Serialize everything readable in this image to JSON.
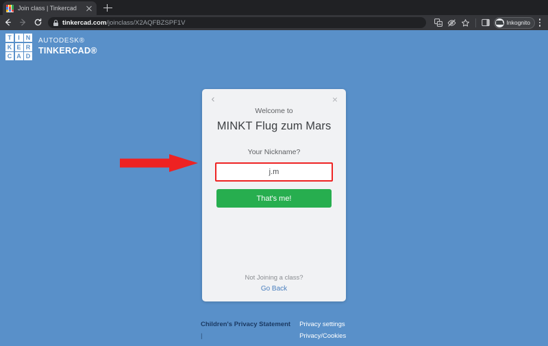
{
  "browser": {
    "tab": {
      "title": "Join class | Tinkercad",
      "favicon": "tinkercad-favicon",
      "close_label": "×",
      "favicon_colors": [
        "#e8453c",
        "#f7b500",
        "#34a853",
        "#4285f4",
        "#e8453c",
        "#34a853",
        "#f7b500",
        "#4285f4",
        "#e8453c"
      ]
    },
    "new_tab_label": "+",
    "nav": {
      "back": "←",
      "forward": "→",
      "reload": "↻"
    },
    "omnibox": {
      "lock_icon": "lock-icon",
      "host": "tinkercad.com",
      "path": "/joinclass/X2AQFBZSPF1V"
    },
    "toolbar_icons": [
      {
        "name": "translate-icon",
        "glyph": "語"
      },
      {
        "name": "eye-slash-icon",
        "glyph": "◎"
      },
      {
        "name": "bookmark-star-icon",
        "glyph": "☆"
      },
      {
        "name": "side-panel-icon",
        "glyph": "▣"
      }
    ],
    "profile": {
      "name": "Inkognito",
      "avatar": "incognito-avatar"
    },
    "menu_label": "⋮"
  },
  "brand": {
    "grid_letters": [
      "T",
      "I",
      "N",
      "K",
      "E",
      "R",
      "C",
      "A",
      "D"
    ],
    "line1": "AUTODESK®",
    "line2": "TINKERCAD®"
  },
  "modal": {
    "back_label": "‹",
    "close_label": "×",
    "welcome": "Welcome to",
    "class_name": "MINKT Flug zum Mars",
    "nickname_label": "Your Nickname?",
    "nickname_value": "j.m",
    "nickname_placeholder": "Your Nickname?",
    "submit_label": "That's me!",
    "not_joining": "Not Joining a class?",
    "go_back": "Go Back"
  },
  "annotation": {
    "name": "red-arrow-pointing-to-nickname-input",
    "color": "#ee2222",
    "direction": "right"
  },
  "footer": {
    "children_privacy": "Children's Privacy Statement",
    "separator": "|",
    "privacy_settings": "Privacy settings",
    "privacy_cookies": "Privacy/Cookies"
  },
  "colors": {
    "page_background": "#5990c9",
    "modal_background": "#f1f2f4",
    "accent_green": "#27ae4f",
    "alert_red": "#ee2222",
    "link_blue": "#4a7fbe"
  }
}
